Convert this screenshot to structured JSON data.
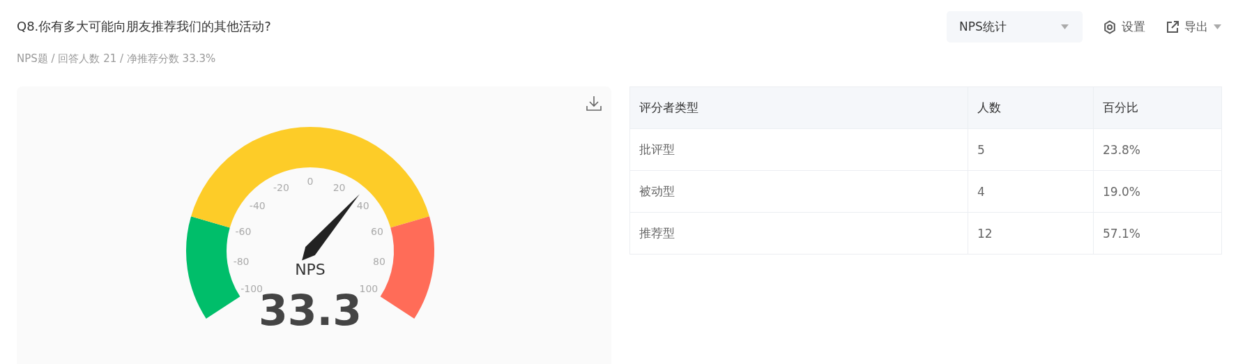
{
  "question": {
    "title": "Q8.你有多大可能向朋友推荐我们的其他活动?",
    "meta": "NPS题 / 回答人数 21 / 净推荐分数 33.3%"
  },
  "toolbar": {
    "chart_select": {
      "value": "NPS统计"
    },
    "settings": "设置",
    "export": "导出"
  },
  "gauge": {
    "label": "NPS",
    "value": "33.3",
    "ticks": [
      "-100",
      "-80",
      "-60",
      "-40",
      "-20",
      "0",
      "20",
      "40",
      "60",
      "80",
      "100"
    ],
    "segments": [
      {
        "color": "#00be6a"
      },
      {
        "color": "#fdcc28"
      },
      {
        "color": "#ff6c58"
      }
    ]
  },
  "table": {
    "columns": [
      "评分者类型",
      "人数",
      "百分比"
    ],
    "rows": [
      [
        "批评型",
        "5",
        "23.8%"
      ],
      [
        "被动型",
        "4",
        "19.0%"
      ],
      [
        "推荐型",
        "12",
        "57.1%"
      ]
    ]
  }
}
